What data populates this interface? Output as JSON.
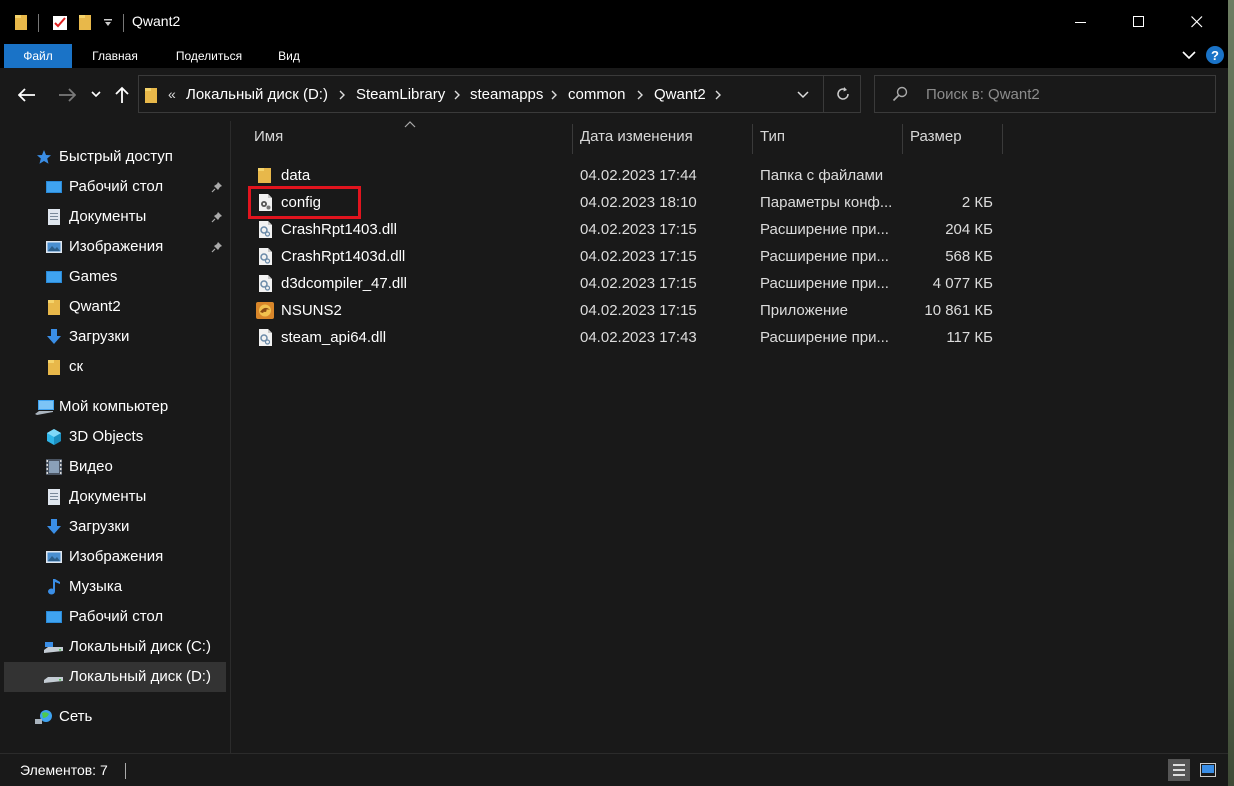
{
  "window": {
    "title": "Qwant2"
  },
  "ribbon": {
    "tabs": [
      {
        "label": "Файл",
        "active": true
      },
      {
        "label": "Главная"
      },
      {
        "label": "Поделиться"
      },
      {
        "label": "Вид"
      }
    ]
  },
  "address": {
    "overflow": "«",
    "crumbs": [
      "Локальный диск (D:)",
      "SteamLibrary",
      "steamapps",
      "common",
      "Qwant2"
    ]
  },
  "search": {
    "placeholder": "Поиск в: Qwant2"
  },
  "sidebar": {
    "quick_access": {
      "label": "Быстрый доступ",
      "items": [
        {
          "label": "Рабочий стол",
          "icon": "desktop-icon",
          "pinned": true
        },
        {
          "label": "Документы",
          "icon": "documents-icon",
          "pinned": true
        },
        {
          "label": "Изображения",
          "icon": "pictures-icon",
          "pinned": true
        },
        {
          "label": "Games",
          "icon": "desktop-icon"
        },
        {
          "label": "Qwant2",
          "icon": "folder-icon"
        },
        {
          "label": "Загрузки",
          "icon": "downloads-icon"
        },
        {
          "label": "ск",
          "icon": "folder-icon"
        }
      ]
    },
    "this_pc": {
      "label": "Мой компьютер",
      "items": [
        {
          "label": "3D Objects",
          "icon": "3d-objects-icon"
        },
        {
          "label": "Видео",
          "icon": "video-icon"
        },
        {
          "label": "Документы",
          "icon": "documents-icon"
        },
        {
          "label": "Загрузки",
          "icon": "downloads-icon"
        },
        {
          "label": "Изображения",
          "icon": "pictures-icon"
        },
        {
          "label": "Музыка",
          "icon": "music-icon"
        },
        {
          "label": "Рабочий стол",
          "icon": "desktop-icon"
        },
        {
          "label": "Локальный диск (C:)",
          "icon": "drive-c-icon"
        },
        {
          "label": "Локальный диск (D:)",
          "icon": "drive-d-icon",
          "selected": true
        }
      ]
    },
    "network": {
      "label": "Сеть",
      "icon": "network-icon"
    }
  },
  "columns": {
    "name": "Имя",
    "date": "Дата изменения",
    "type": "Тип",
    "size": "Размер"
  },
  "files": [
    {
      "name": "data",
      "date": "04.02.2023 17:44",
      "type": "Папка с файлами",
      "size": "",
      "icon": "folder-icon"
    },
    {
      "name": "config",
      "date": "04.02.2023 18:10",
      "type": "Параметры конф...",
      "size": "2 КБ",
      "icon": "config-file-icon",
      "highlighted": true
    },
    {
      "name": "CrashRpt1403.dll",
      "date": "04.02.2023 17:15",
      "type": "Расширение при...",
      "size": "204 КБ",
      "icon": "dll-file-icon"
    },
    {
      "name": "CrashRpt1403d.dll",
      "date": "04.02.2023 17:15",
      "type": "Расширение при...",
      "size": "568 КБ",
      "icon": "dll-file-icon"
    },
    {
      "name": "d3dcompiler_47.dll",
      "date": "04.02.2023 17:15",
      "type": "Расширение при...",
      "size": "4 077 КБ",
      "icon": "dll-file-icon"
    },
    {
      "name": "NSUNS2",
      "date": "04.02.2023 17:15",
      "type": "Приложение",
      "size": "10 861 КБ",
      "icon": "app-icon"
    },
    {
      "name": "steam_api64.dll",
      "date": "04.02.2023 17:43",
      "type": "Расширение при...",
      "size": "117 КБ",
      "icon": "dll-file-icon"
    }
  ],
  "status": {
    "items_count": "Элементов: 7"
  },
  "colors": {
    "accent": "#1a73c7",
    "highlight": "#e1141e",
    "background": "#191919"
  }
}
